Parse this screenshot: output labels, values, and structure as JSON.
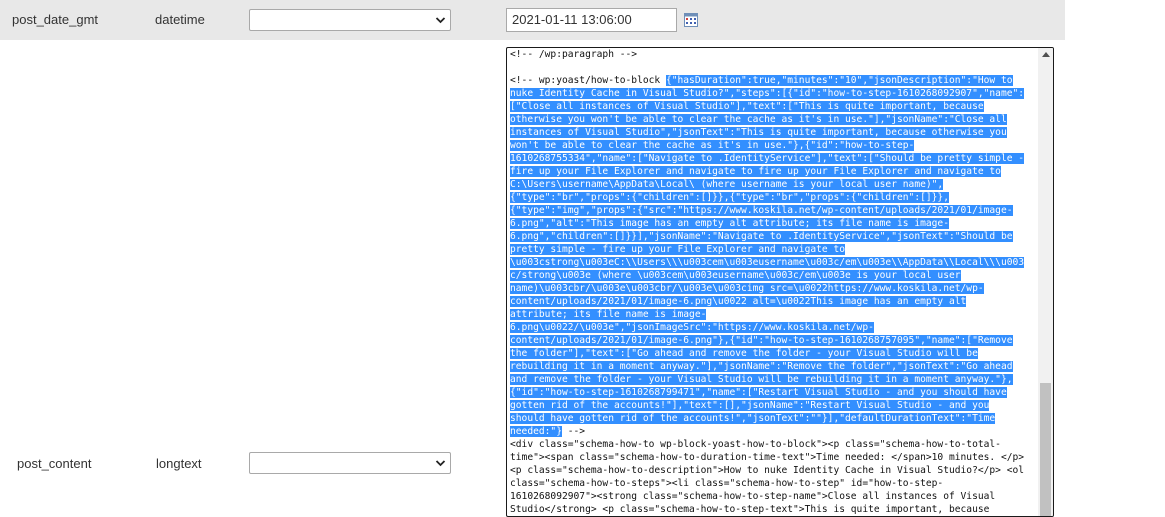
{
  "row1": {
    "field": "post_date_gmt",
    "type": "datetime",
    "function_value": "",
    "value": "2021-01-11 13:06:00"
  },
  "row2": {
    "field": "post_content",
    "type": "longtext",
    "function_value": ""
  },
  "content_lines": [
    [
      {
        "t": "<!-- /wp:paragraph -->",
        "h": false
      }
    ],
    [
      {
        "t": "",
        "h": false
      }
    ],
    [
      {
        "t": "<!-- wp:yoast/how-to-block ",
        "h": false
      },
      {
        "t": "{\"hasDuration\":true,\"minutes\":\"10\",\"jsonDescription\":\"How to",
        "h": true
      }
    ],
    [
      {
        "t": "nuke Identity Cache in Visual Studio?\",\"steps\":[{\"id\":\"how-to-step-1610268092907\",\"name\":",
        "h": true
      }
    ],
    [
      {
        "t": "[\"Close all instances of Visual Studio\"],\"text\":[\"This is quite important, because",
        "h": true
      }
    ],
    [
      {
        "t": "otherwise you won't be able to clear the cache as it's in use.\"],\"jsonName\":\"Close all",
        "h": true
      }
    ],
    [
      {
        "t": "instances of Visual Studio\",\"jsonText\":\"This is quite important, because otherwise you",
        "h": true
      }
    ],
    [
      {
        "t": "won't be able to clear the cache as it's in use.\"},{\"id\":\"how-to-step-",
        "h": true
      }
    ],
    [
      {
        "t": "1610268755334\",\"name\":[\"Navigate to .IdentityService\"],\"text\":[\"Should be pretty simple -",
        "h": true
      }
    ],
    [
      {
        "t": "fire up your File Explorer and navigate to fire up your File Explorer and navigate to",
        "h": true
      }
    ],
    [
      {
        "t": "C:\\Users\\username\\AppData\\Local\\ (where username is your local user name)\",",
        "h": true
      }
    ],
    [
      {
        "t": "{\"type\":\"br\",\"props\":{\"children\":[]}},{\"type\":\"br\",\"props\":{\"children\":[]}},",
        "h": true
      }
    ],
    [
      {
        "t": "{\"type\":\"img\",\"props\":{\"src\":\"https://www.koskila.net/wp-content/uploads/2021/01/image-",
        "h": true
      }
    ],
    [
      {
        "t": "6.png\",\"alt\":\"This image has an empty alt attribute; its file name is image-",
        "h": true
      }
    ],
    [
      {
        "t": "6.png\",\"children\":[]}}],\"jsonName\":\"Navigate to .IdentityService\",\"jsonText\":\"Should be",
        "h": true
      }
    ],
    [
      {
        "t": "pretty simple - fire up your File Explorer and navigate to",
        "h": true
      }
    ],
    [
      {
        "t": "\\u003cstrong\\u003eC:\\\\Users\\\\\\u003cem\\u003eusername\\u003c/em\\u003e\\\\AppData\\\\Local\\\\\\u003",
        "h": true
      }
    ],
    [
      {
        "t": "c/strong\\u003e (where \\u003cem\\u003eusername\\u003c/em\\u003e is your local user",
        "h": true
      }
    ],
    [
      {
        "t": "name)\\u003cbr/\\u003e\\u003cbr/\\u003e\\u003cimg src=\\u0022https://www.koskila.net/wp-",
        "h": true
      }
    ],
    [
      {
        "t": "content/uploads/2021/01/image-6.png\\u0022 alt=\\u0022This image has an empty alt",
        "h": true
      }
    ],
    [
      {
        "t": "attribute; its file name is image-",
        "h": true
      }
    ],
    [
      {
        "t": "6.png\\u0022/\\u003e\",\"jsonImageSrc\":\"https://www.koskila.net/wp-",
        "h": true
      }
    ],
    [
      {
        "t": "content/uploads/2021/01/image-6.png\"},{\"id\":\"how-to-step-1610268757095\",\"name\":[\"Remove",
        "h": true
      }
    ],
    [
      {
        "t": "the folder\"],\"text\":[\"Go ahead and remove the folder - your Visual Studio will be",
        "h": true
      }
    ],
    [
      {
        "t": "rebuilding it in a moment anyway.\"],\"jsonName\":\"Remove the folder\",\"jsonText\":\"Go ahead",
        "h": true
      }
    ],
    [
      {
        "t": "and remove the folder - your Visual Studio will be rebuilding it in a moment anyway.\"},",
        "h": true
      }
    ],
    [
      {
        "t": "{\"id\":\"how-to-step-1610268799471\",\"name\":[\"Restart Visual Studio - and you should have",
        "h": true
      }
    ],
    [
      {
        "t": "gotten rid of the accounts!\"],\"text\":[],\"jsonName\":\"Restart Visual Studio - and you",
        "h": true
      }
    ],
    [
      {
        "t": "should have gotten rid of the accounts!\",\"jsonText\":\"\"}],\"defaultDurationText\":\"Time",
        "h": true
      }
    ],
    [
      {
        "t": "needed:\"}",
        "h": true
      },
      {
        "t": " -->",
        "h": false
      }
    ],
    [
      {
        "t": "<div class=\"schema-how-to wp-block-yoast-how-to-block\"><p class=\"schema-how-to-total-",
        "h": false
      }
    ],
    [
      {
        "t": "time\"><span class=\"schema-how-to-duration-time-text\">Time needed: </span>10 minutes. </p>",
        "h": false
      }
    ],
    [
      {
        "t": "<p class=\"schema-how-to-description\">How to nuke Identity Cache in Visual Studio?</p> <ol",
        "h": false
      }
    ],
    [
      {
        "t": "class=\"schema-how-to-steps\"><li class=\"schema-how-to-step\" id=\"how-to-step-",
        "h": false
      }
    ],
    [
      {
        "t": "1610268092907\"><strong class=\"schema-how-to-step-name\">Close all instances of Visual",
        "h": false
      }
    ],
    [
      {
        "t": "Studio</strong> <p class=\"schema-how-to-step-text\">This is quite important, because",
        "h": false
      }
    ]
  ]
}
